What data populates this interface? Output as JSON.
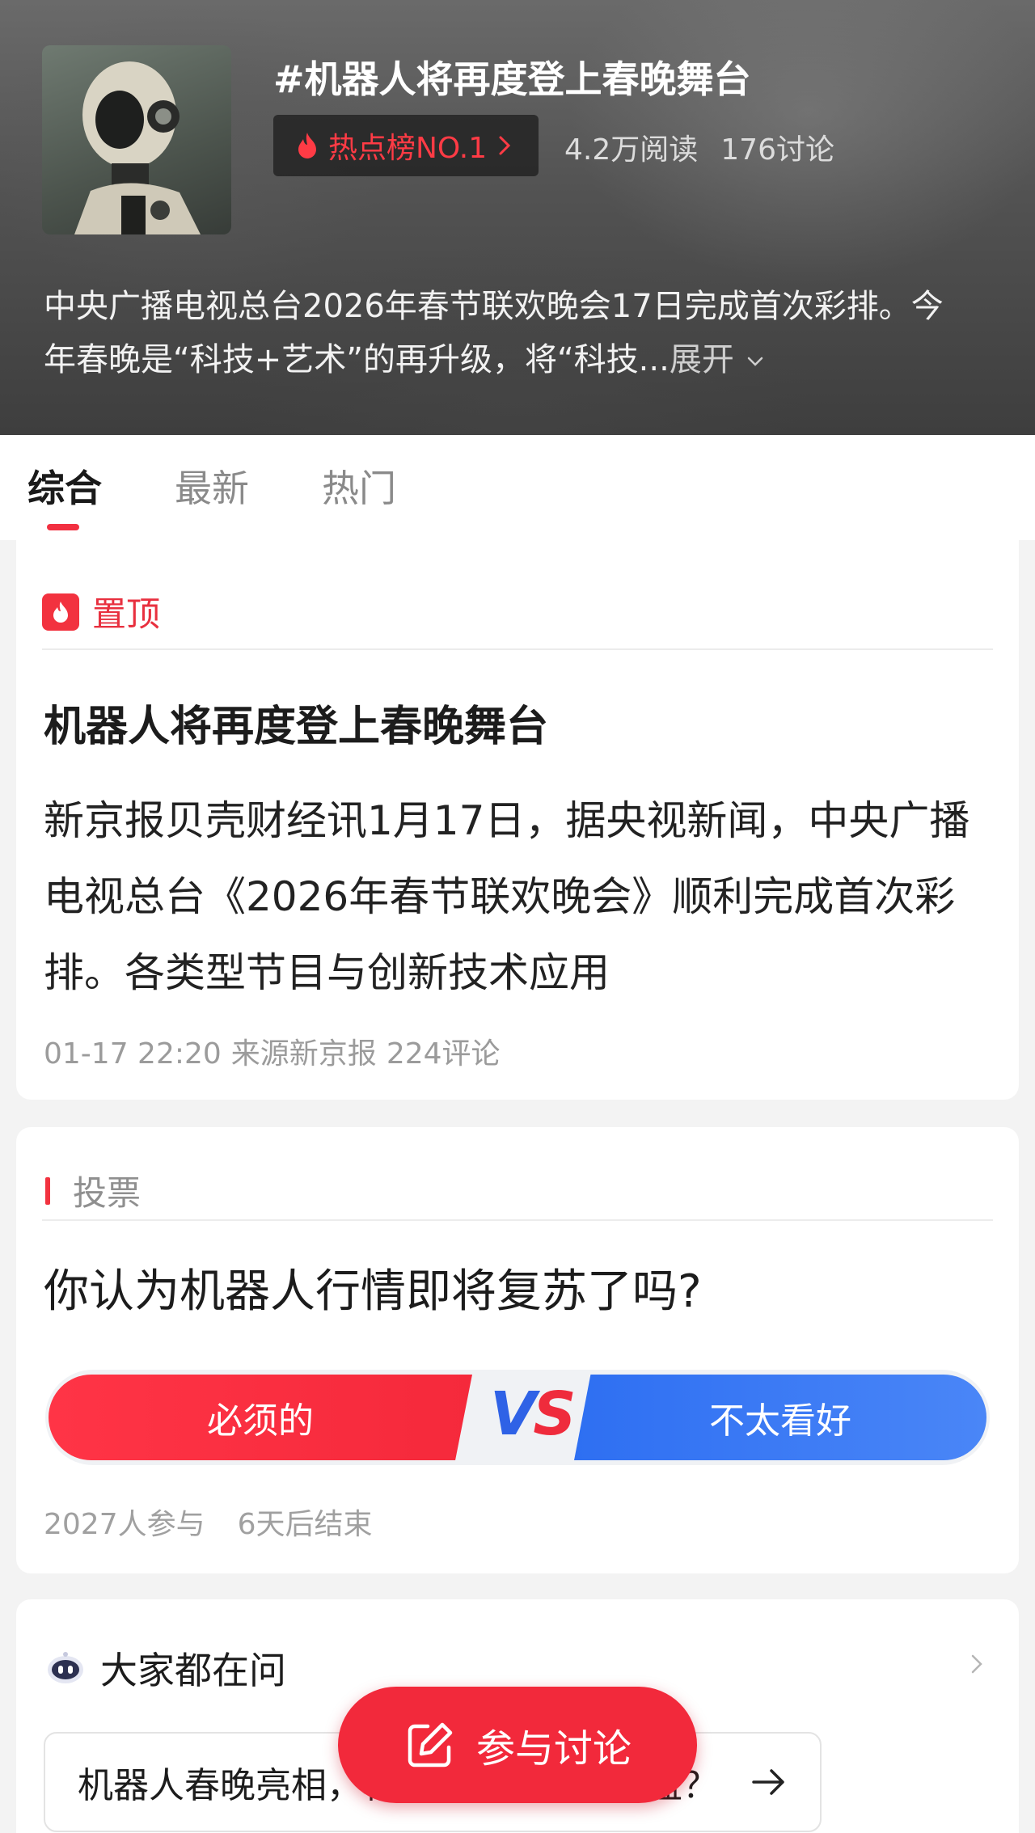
{
  "header": {
    "topic_title": "#机器人将再度登上春晚舞台",
    "hot_badge": "热点榜NO.1",
    "reads": "4.2万阅读",
    "discussions": "176讨论",
    "description": "中央广播电视总台2026年春节联欢晚会17日完成首次彩排。今年春晚是“科技+艺术”的再升级，将“科技...",
    "expand_label": "展开"
  },
  "tabs": [
    {
      "label": "综合",
      "active": true
    },
    {
      "label": "最新",
      "active": false
    },
    {
      "label": "热门",
      "active": false
    }
  ],
  "pinned": {
    "tag": "置顶",
    "title": "机器人将再度登上春晚舞台",
    "body": "新京报贝壳财经讯1月17日，据央视新闻，中央广播电视总台《2026年春节联欢晚会》顺利完成首次彩排。各类型节目与创新技术应用",
    "time": "01-17 22:20",
    "source": "来源新京报",
    "comments": "224评论"
  },
  "vote": {
    "tag": "投票",
    "question": "你认为机器人行情即将复苏了吗?",
    "option_a": "必须的",
    "vs_v": "V",
    "vs_s": "S",
    "option_b": "不太看好",
    "participants": "2027人参与",
    "ends": "6天后结束"
  },
  "ask": {
    "title": "大家都在问",
    "question": "机器人春晚亮相，相关概念股能否受益？"
  },
  "fab": {
    "label": "参与讨论"
  },
  "colors": {
    "accent_red": "#f2293b",
    "accent_blue": "#2e6ff2"
  },
  "icons": [
    "flame-icon",
    "chevron-right-icon",
    "chevron-down-icon",
    "pin-flame-icon",
    "robot-icon",
    "arrow-right-icon",
    "edit-icon"
  ]
}
